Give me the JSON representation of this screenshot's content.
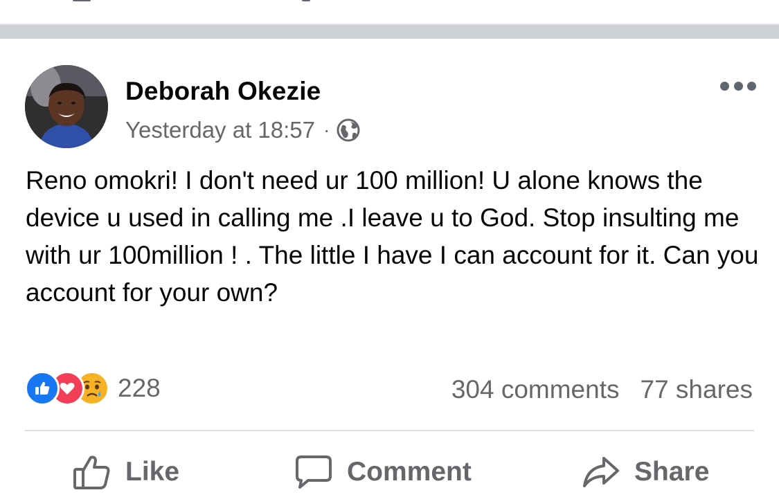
{
  "post": {
    "author": "Deborah Okezie",
    "timestamp": "Yesterday at 18:57",
    "separator_dot": "·",
    "privacy_icon": "globe-icon",
    "text": "Reno omokri!  I don't need ur 100 million! U alone knows the  device u used in calling me .I leave u to God. Stop insulting me with ur 100million ! . The little I have I can account for it. Can you account for your own?"
  },
  "reactions": {
    "types": [
      "like",
      "love",
      "sad"
    ],
    "count": "228"
  },
  "engagement": {
    "comments": "304 comments",
    "shares": "77 shares"
  },
  "actions": {
    "like": "Like",
    "comment": "Comment",
    "share": "Share"
  },
  "colors": {
    "like_blue": "#1877f2",
    "love_red": "#f33e58",
    "sad_yellow": "#f7b125",
    "secondary_text": "#65676b",
    "separator": "#cdd0d4"
  }
}
